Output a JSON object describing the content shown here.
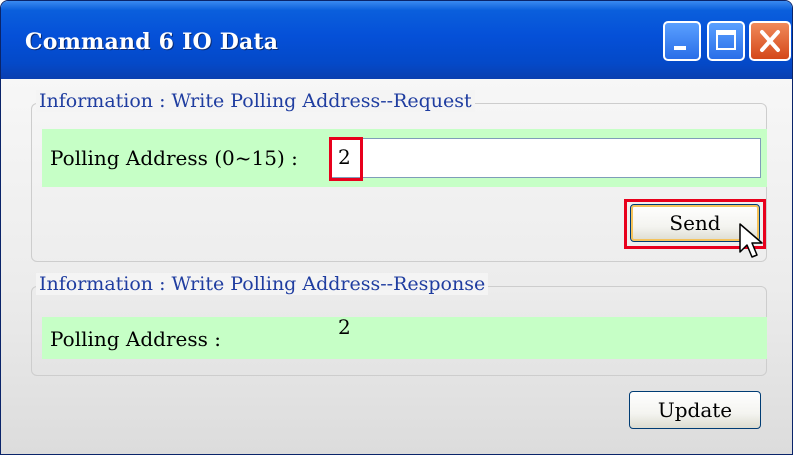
{
  "window": {
    "title": "Command 6 IO Data"
  },
  "request_group": {
    "caption": "Information : Write Polling Address--Request",
    "field_label": "Polling Address (0~15) :",
    "field_value": "2",
    "send_label": "Send"
  },
  "response_group": {
    "caption": "Information : Write Polling Address--Response",
    "field_label": "Polling Address :",
    "field_value": "2"
  },
  "footer": {
    "update_label": "Update"
  },
  "icons": [
    "minimize-icon",
    "maximize-icon",
    "close-icon",
    "mouse-pointer-icon"
  ],
  "colors": {
    "titlebar": "#0550d8",
    "highlight_panel": "#c6ffc6",
    "annotation_red": "#e8001c",
    "caption_text": "#1f3da0"
  }
}
